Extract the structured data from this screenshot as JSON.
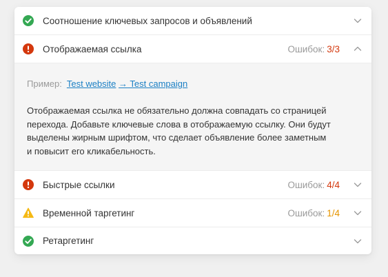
{
  "colors": {
    "success": "#34a853",
    "error": "#d4380d",
    "warning": "#f5b914",
    "error_count": "#d4380d",
    "warning_count": "#e69500",
    "link": "#1a7fc4"
  },
  "sections": [
    {
      "title": "Соотношение ключевых запросов и объявлений",
      "status_icon": "check-circle-icon",
      "errors_label": "",
      "errors_count": "",
      "chevron": "chevron-down-icon"
    },
    {
      "title": "Отображаемая ссылка",
      "status_icon": "error-circle-icon",
      "errors_label": "Ошибок:",
      "errors_count": "3/3",
      "chevron": "chevron-up-icon",
      "expanded": true,
      "details": {
        "example_label": "Пример:",
        "link1": "Test website",
        "arrow": "→",
        "link2": " Test campaign",
        "description_lines": [
          "Отображаемая ссылка не обязательно должна совпадать со страницей",
          "перехода. Добавьте ключевые слова в отображаемую ссылку. Они будут",
          "выделены жирным шрифтом, что сделает объявление более заметным",
          "и повысит его кликабельность."
        ]
      }
    },
    {
      "title": "Быстрые ссылки",
      "status_icon": "error-circle-icon",
      "errors_label": "Ошибок:",
      "errors_count": "4/4",
      "chevron": "chevron-down-icon"
    },
    {
      "title": "Временной таргетинг",
      "status_icon": "warning-triangle-icon",
      "errors_label": "Ошибок:",
      "errors_count": "1/4",
      "chevron": "chevron-down-icon"
    },
    {
      "title": "Ретаргетинг",
      "status_icon": "check-circle-icon",
      "errors_label": "",
      "errors_count": "",
      "chevron": "chevron-down-icon"
    }
  ]
}
